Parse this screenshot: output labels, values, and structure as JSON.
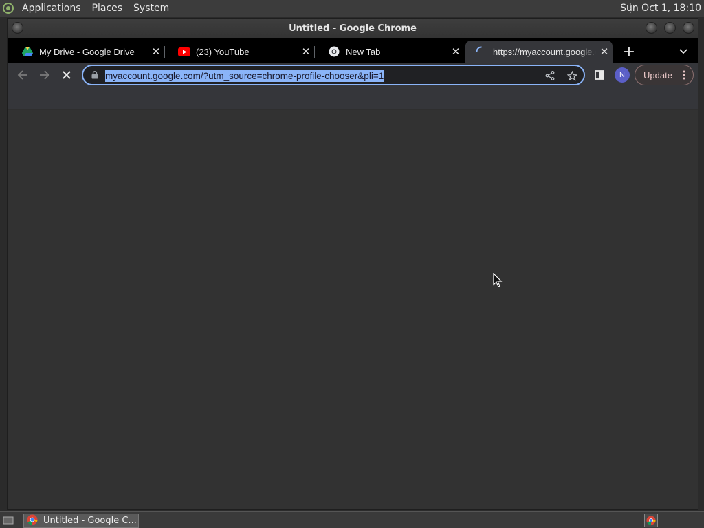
{
  "system_panel": {
    "menus": [
      "Applications",
      "Places",
      "System"
    ],
    "clock": "Sun Oct  1, 18:10"
  },
  "window": {
    "title": "Untitled - Google Chrome"
  },
  "tabs": [
    {
      "title": "My Drive - Google Drive",
      "icon": "google-drive-icon"
    },
    {
      "title": "(23) YouTube",
      "icon": "youtube-icon"
    },
    {
      "title": "New Tab",
      "icon": "chrome-icon"
    },
    {
      "title": "https://myaccount.google.com",
      "icon": "loading-spinner-icon",
      "active": true
    }
  ],
  "toolbar": {
    "url": "myaccount.google.com/?utm_source=chrome-profile-chooser&pli=1",
    "avatar_initial": "N",
    "update_label": "Update"
  },
  "taskbar": {
    "window_label": "Untitled - Google C..."
  },
  "colors": {
    "accent": "#8ab4f8",
    "tabstrip_bg": "#000000",
    "toolbar_bg": "#35363a",
    "content_bg": "#323232"
  }
}
